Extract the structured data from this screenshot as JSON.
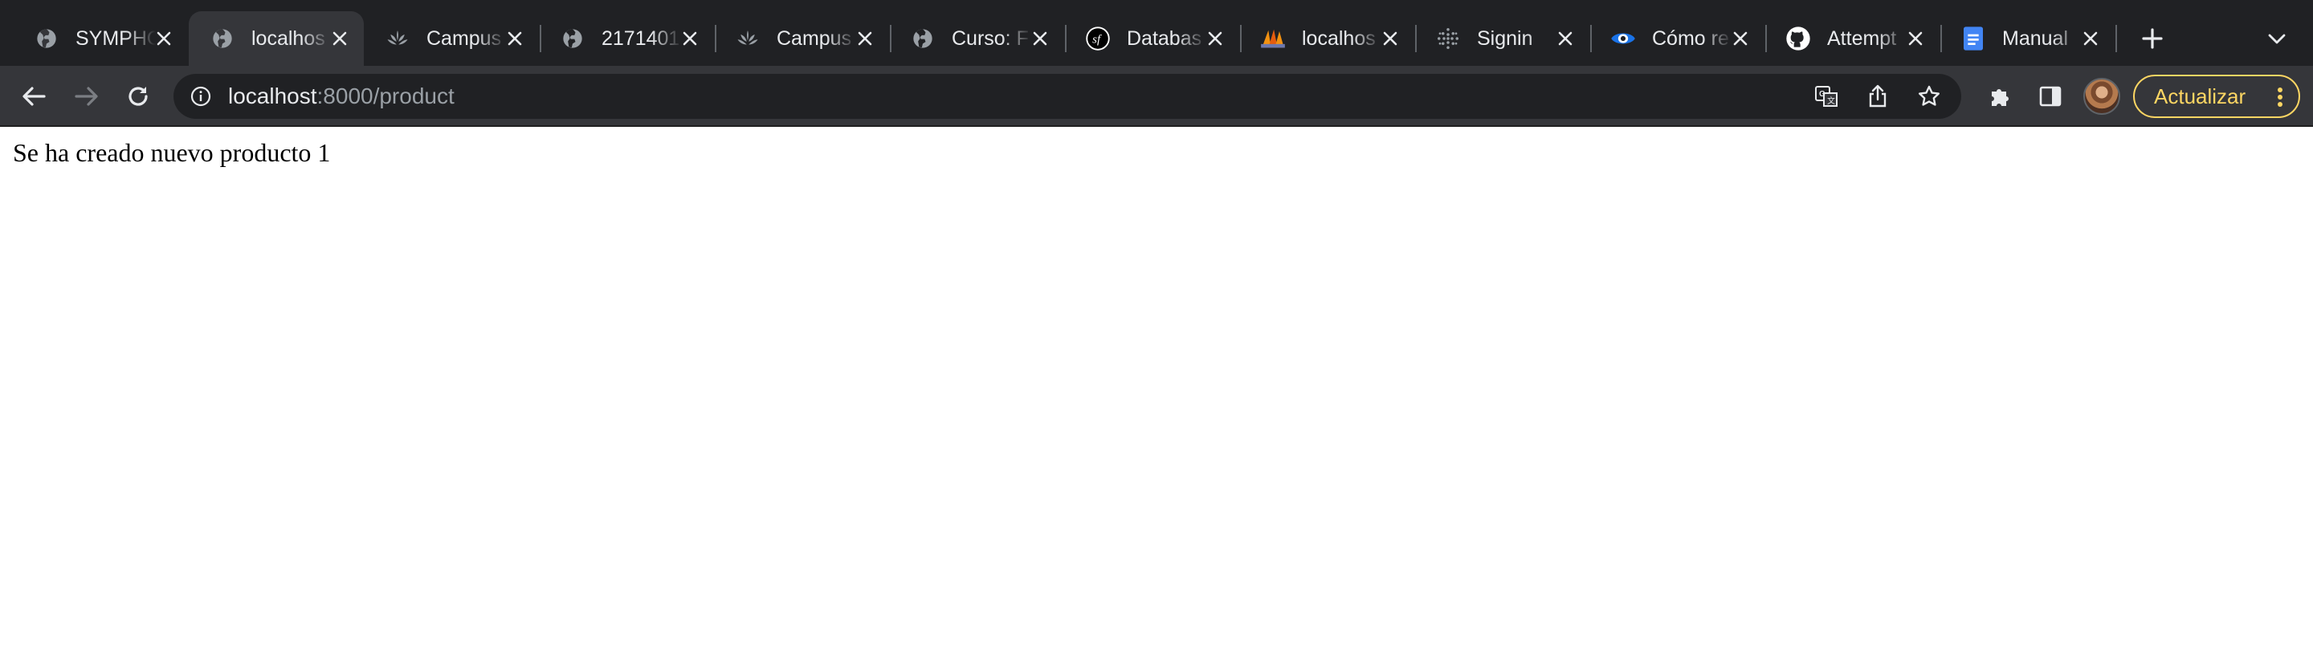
{
  "browser": {
    "tabs": [
      {
        "title": "SYMPHO",
        "icon": "globe-icon",
        "active": false
      },
      {
        "title": "localhos",
        "icon": "globe-icon",
        "active": true
      },
      {
        "title": "Campus",
        "icon": "campus-icon",
        "active": false
      },
      {
        "title": "2171401",
        "icon": "globe-icon",
        "active": false
      },
      {
        "title": "Campus",
        "icon": "campus-icon",
        "active": false
      },
      {
        "title": "Curso: F",
        "icon": "globe-icon",
        "active": false
      },
      {
        "title": "Databas",
        "icon": "symfony-icon",
        "active": false
      },
      {
        "title": "localhos",
        "icon": "phpmyadmin-icon",
        "active": false
      },
      {
        "title": "Signin",
        "icon": "dots-icon",
        "active": false
      },
      {
        "title": "Cómo re",
        "icon": "eye-icon",
        "active": false
      },
      {
        "title": "Attempt",
        "icon": "github-icon",
        "active": false
      },
      {
        "title": "Manual",
        "icon": "docs-icon",
        "active": false
      }
    ],
    "address": {
      "host": "localhost",
      "path": ":8000/product"
    },
    "update_button_label": "Actualizar",
    "colors": {
      "tabstrip_bg": "#202124",
      "toolbar_bg": "#35363a",
      "update_accent": "#fdd663"
    }
  },
  "page": {
    "message": "Se ha creado nuevo producto 1"
  }
}
